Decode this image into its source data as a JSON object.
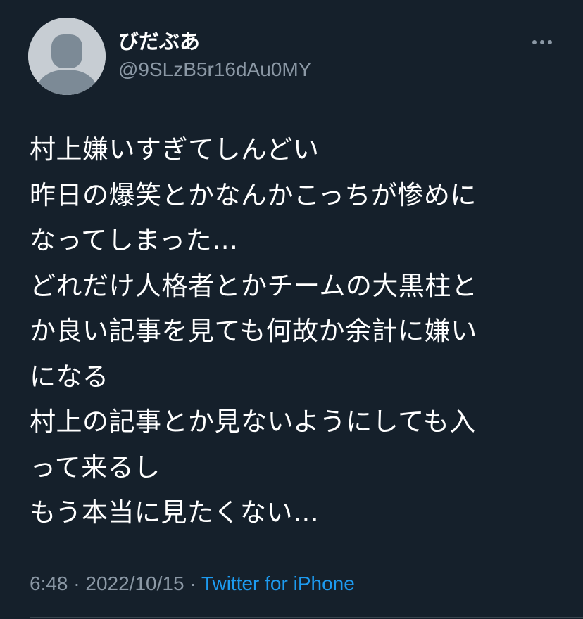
{
  "user": {
    "display_name": "びだぶあ",
    "handle": "@9SLzB5r16dAu0MY",
    "avatar_icon": "default-profile-icon"
  },
  "more_icon": "more-dots-icon",
  "tweet": {
    "lines": [
      "村上嫌いすぎてしんどい",
      "昨日の爆笑とかなんかこっちが惨めに",
      "なってしまった…",
      "どれだけ人格者とかチームの大黒柱と",
      "か良い記事を見ても何故か余計に嫌い",
      "になる",
      "村上の記事とか見ないようにしても入",
      "って来るし",
      "もう本当に見たくない…"
    ]
  },
  "meta": {
    "time": "6:48",
    "separator1": " · ",
    "date": "2022/10/15",
    "separator2": " · ",
    "source": "Twitter for iPhone"
  },
  "colors": {
    "background": "#15202b",
    "text": "#ffffff",
    "muted": "#8b98a5",
    "link": "#1d9bf0",
    "avatar_bg": "#c7cdd3",
    "avatar_fg": "#7c8a96"
  }
}
